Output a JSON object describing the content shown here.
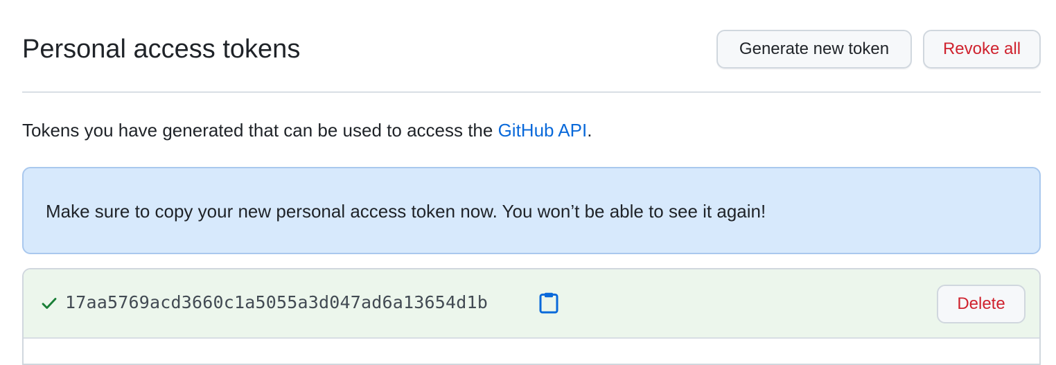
{
  "header": {
    "title": "Personal access tokens",
    "generate_label": "Generate new token",
    "revoke_label": "Revoke all"
  },
  "description": {
    "prefix": "Tokens you have generated that can be used to access the ",
    "link_text": "GitHub API",
    "suffix": "."
  },
  "flash": {
    "message": "Make sure to copy your new personal access token now. You won’t be able to see it again!"
  },
  "tokens": [
    {
      "value": "17aa5769acd3660c1a5055a3d047ad6a13654d1b",
      "status_icon": "check-icon",
      "copy_icon": "clipboard-icon",
      "delete_label": "Delete"
    }
  ],
  "colors": {
    "link": "#0969da",
    "danger": "#cf222e",
    "success": "#1a7f37",
    "flash_bg": "#d7e9fc",
    "token_row_bg": "#ecf6ec"
  }
}
